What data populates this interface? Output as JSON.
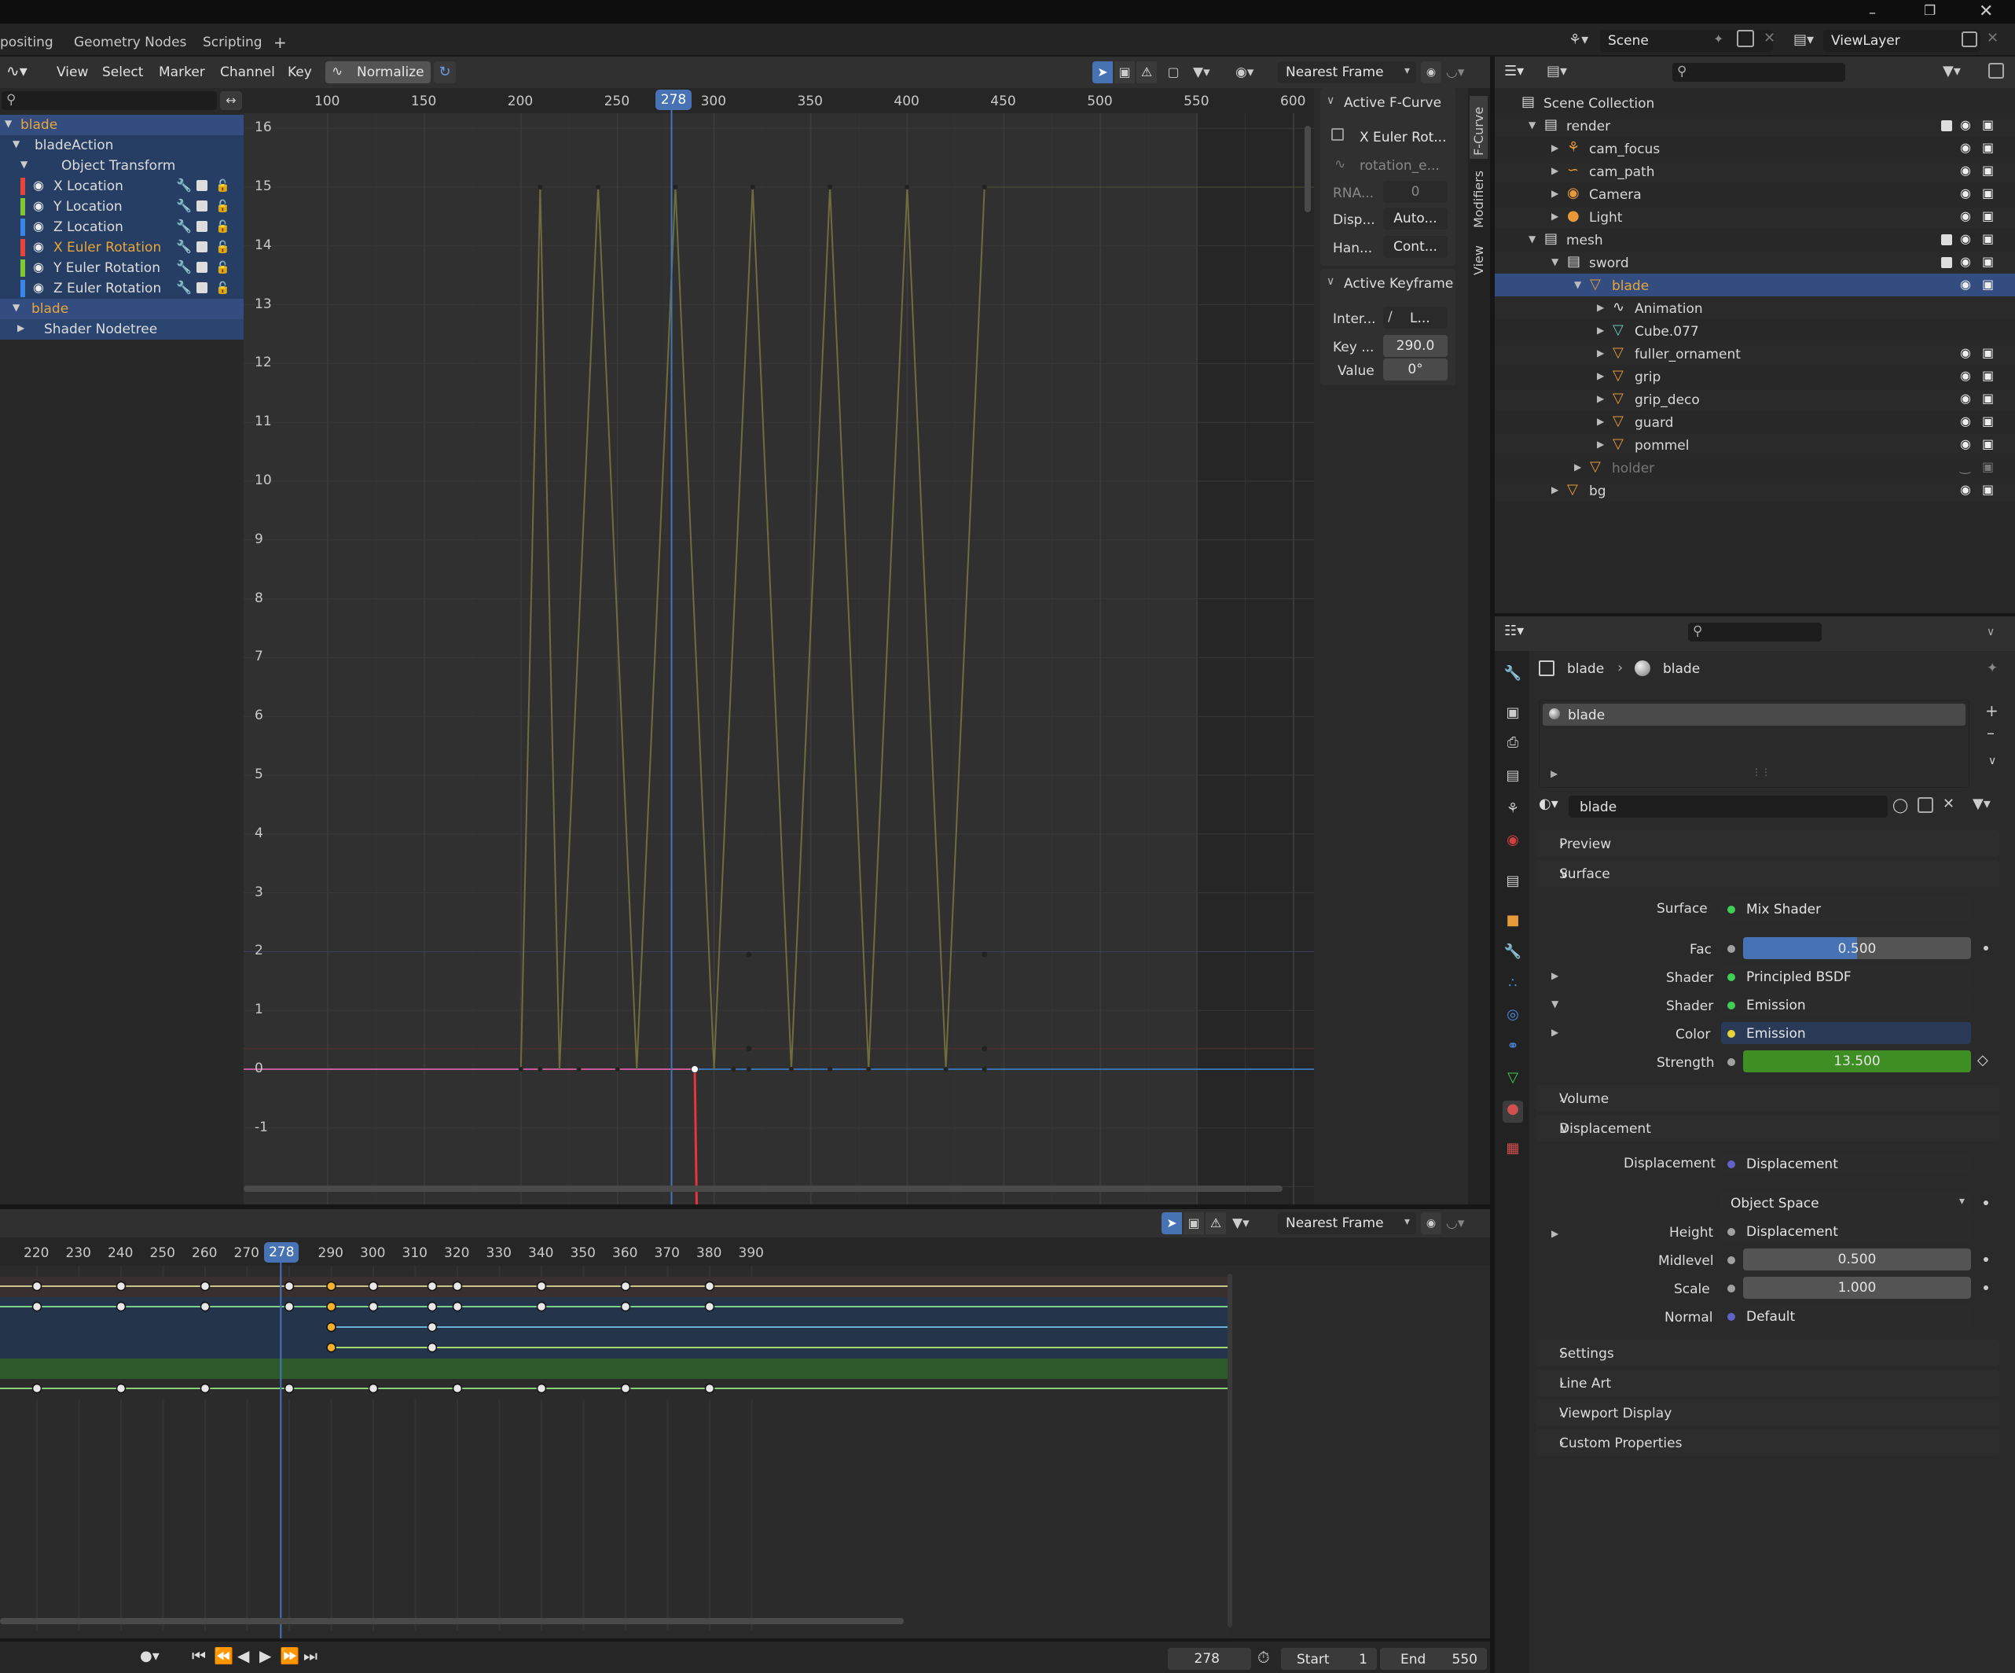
{
  "topbar": {
    "tabs": [
      "positing",
      "Geometry Nodes",
      "Scripting",
      "+"
    ]
  },
  "graph_header": {
    "menus": [
      "View",
      "Select",
      "Marker",
      "Channel",
      "Key"
    ],
    "normalize_label": "Normalize",
    "snap_mode": "Nearest Frame",
    "current_frame": "278"
  },
  "graph_x_ticks": [
    "100",
    "150",
    "200",
    "250",
    "300",
    "350",
    "400",
    "450",
    "500",
    "550",
    "600"
  ],
  "graph_y_ticks": [
    "16",
    "15",
    "14",
    "13",
    "12",
    "11",
    "10",
    "9",
    "8",
    "7",
    "6",
    "5",
    "4",
    "3",
    "2",
    "1",
    "0",
    "-1"
  ],
  "channels": [
    {
      "label": "blade",
      "color": "#e8a63a",
      "selected": true
    },
    {
      "label": "bladeAction",
      "color": "#dcdcdc"
    },
    {
      "label": "Object Transform",
      "color": "#dcdcdc"
    },
    {
      "label": "X Location",
      "color": "#dcdcdc",
      "swatch": "#e8443a"
    },
    {
      "label": "Y Location",
      "color": "#dcdcdc",
      "swatch": "#7fc733"
    },
    {
      "label": "Z Location",
      "color": "#dcdcdc",
      "swatch": "#3a86e8"
    },
    {
      "label": "X Euler Rotation",
      "color": "#e8a63a",
      "swatch": "#e8443a"
    },
    {
      "label": "Y Euler Rotation",
      "color": "#dcdcdc",
      "swatch": "#7fc733"
    },
    {
      "label": "Z Euler Rotation",
      "color": "#dcdcdc",
      "swatch": "#3a86e8"
    },
    {
      "label": "blade",
      "color": "#e8a63a"
    },
    {
      "label": "Shader Nodetree",
      "color": "#dcdcdc"
    }
  ],
  "active_fcurve": {
    "title": "Active F-Curve",
    "name": "X Euler Rot...",
    "path": "rotation_e...",
    "rna_label": "RNA...",
    "rna_value": "0",
    "disp_label": "Disp...",
    "disp_value": "Auto...",
    "han_label": "Han...",
    "han_value": "Cont..."
  },
  "active_keyframe": {
    "title": "Active Keyframe",
    "inter_label": "Inter...",
    "inter_value": "L...",
    "key_label": "Key ...",
    "key_value": "290.0",
    "value_label": "Value",
    "value_value": "0°"
  },
  "sidebar_tabs": [
    "F-Curve",
    "Modifiers",
    "View"
  ],
  "dope_header": {
    "snap_mode": "Nearest Frame",
    "current_frame": "278"
  },
  "dope_ticks": [
    "220",
    "230",
    "240",
    "250",
    "260",
    "270",
    "278",
    "290",
    "300",
    "310",
    "320",
    "330",
    "340",
    "350",
    "360",
    "370",
    "380",
    "390"
  ],
  "dope_keys": {
    "row1": [
      220,
      240,
      260,
      280,
      290,
      300,
      314,
      320,
      340,
      360,
      380
    ],
    "row2": [
      220,
      240,
      260,
      280,
      290,
      300,
      314,
      320,
      340,
      360,
      380
    ],
    "row3": [
      290,
      314
    ],
    "row4": [
      290,
      314
    ],
    "row5": [
      220,
      240,
      260,
      280,
      300,
      320,
      340,
      360,
      380
    ]
  },
  "playback": {
    "current_frame": "278",
    "start_label": "Start",
    "start_value": "1",
    "end_label": "End",
    "end_value": "550"
  },
  "outliner_header": {
    "scene": "Scene",
    "view_layer": "ViewLayer"
  },
  "outliner": [
    {
      "label": "Scene Collection",
      "indent": 0,
      "icon": "collection"
    },
    {
      "label": "render",
      "indent": 1,
      "icon": "collection",
      "check": true
    },
    {
      "label": "cam_focus",
      "indent": 2,
      "icon": "empty"
    },
    {
      "label": "cam_path",
      "indent": 2,
      "icon": "curve"
    },
    {
      "label": "Camera",
      "indent": 2,
      "icon": "camera"
    },
    {
      "label": "Light",
      "indent": 2,
      "icon": "light"
    },
    {
      "label": "mesh",
      "indent": 1,
      "icon": "collection",
      "check": true
    },
    {
      "label": "sword",
      "indent": 2,
      "icon": "collection",
      "check": true
    },
    {
      "label": "blade",
      "indent": 3,
      "icon": "mesh",
      "selected": true
    },
    {
      "label": "Animation",
      "indent": 4,
      "icon": "anim"
    },
    {
      "label": "Cube.077",
      "indent": 4,
      "icon": "meshdata"
    },
    {
      "label": "fuller_ornament",
      "indent": 4,
      "icon": "mesh"
    },
    {
      "label": "grip",
      "indent": 4,
      "icon": "mesh"
    },
    {
      "label": "grip_deco",
      "indent": 4,
      "icon": "mesh"
    },
    {
      "label": "guard",
      "indent": 4,
      "icon": "mesh"
    },
    {
      "label": "pommel",
      "indent": 4,
      "icon": "mesh"
    },
    {
      "label": "holder",
      "indent": 3,
      "icon": "mesh",
      "dim": true
    },
    {
      "label": "bg",
      "indent": 2,
      "icon": "mesh"
    }
  ],
  "properties": {
    "breadcrumb_object": "blade",
    "breadcrumb_material": "blade",
    "slot_name": "blade",
    "material_name": "blade",
    "sections": {
      "preview": "Preview",
      "surface": "Surface",
      "volume": "Volume",
      "displacement": "Displacement",
      "settings": "Settings",
      "line_art": "Line Art",
      "viewport_display": "Viewport Display",
      "custom_properties": "Custom Properties"
    },
    "surface": {
      "surface_label": "Surface",
      "surface_value": "Mix Shader",
      "fac_label": "Fac",
      "fac_value": "0.500",
      "fac_fraction": 0.5,
      "shader1_label": "Shader",
      "shader1_value": "Principled BSDF",
      "shader2_label": "Shader",
      "shader2_value": "Emission",
      "color_label": "Color",
      "color_value": "Emission",
      "strength_label": "Strength",
      "strength_value": "13.500"
    },
    "displacement": {
      "disp_label": "Displacement",
      "disp_value": "Displacement",
      "space_value": "Object Space",
      "height_label": "Height",
      "height_value": "Displacement",
      "midlevel_label": "Midlevel",
      "midlevel_value": "0.500",
      "scale_label": "Scale",
      "scale_value": "1.000",
      "normal_label": "Normal",
      "normal_value": "Default"
    }
  },
  "colors": {
    "accent": "#4772b3",
    "selected_row": "#334d80",
    "x_channel": "#e8443a",
    "y_channel": "#7fc733",
    "z_channel": "#3a86e8",
    "key_selected": "#f5b12a",
    "strength_bar": "#3e8e24"
  }
}
